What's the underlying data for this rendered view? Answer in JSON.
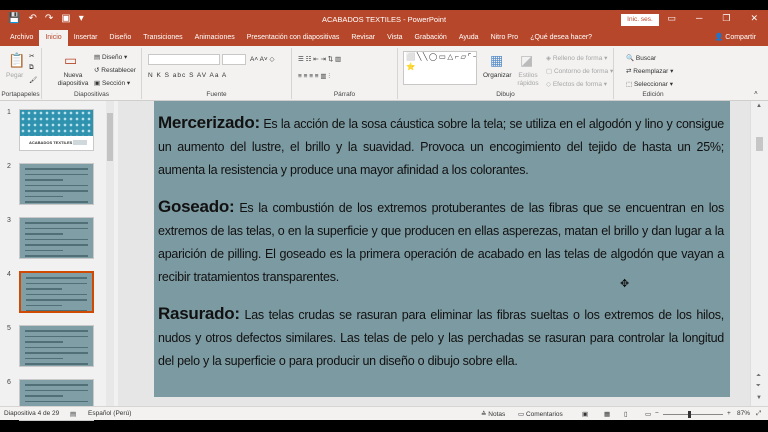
{
  "window": {
    "title": "ACABADOS TEXTILES  -  PowerPoint",
    "sign_in": "Inic. ses.",
    "quick_access": [
      "💾",
      "↶",
      "↷",
      "▣",
      "▾"
    ],
    "controls": [
      "▭",
      "─",
      "❐",
      "✕"
    ]
  },
  "tabs": [
    "Archivo",
    "Inicio",
    "Insertar",
    "Diseño",
    "Transiciones",
    "Animaciones",
    "Presentación con diapositivas",
    "Revisar",
    "Vista",
    "Grabación",
    "Ayuda",
    "Nitro Pro",
    "¿Qué desea hacer?"
  ],
  "active_tab": "Inicio",
  "share_label": "Compartir",
  "ribbon": {
    "portapapeles": {
      "paste": "Pegar",
      "label": "Portapapeles"
    },
    "diapositivas": {
      "new_slide": "Nueva diapositiva",
      "layout": "Diseño",
      "reset": "Restablecer",
      "section": "Sección",
      "label": "Diapositivas"
    },
    "fuente": {
      "format_buttons": "N  K  S  abc  S  AV  Aa  A",
      "label": "Fuente"
    },
    "parrafo": {
      "label": "Párrafo"
    },
    "dibujo": {
      "shapes": "⬜╲╲◯▭△⌐▱⌜⟶⬠⟨⟩⭐",
      "arrange": "Organizar",
      "quick_styles": "Estilos rápidos",
      "fill": "Relleno de forma",
      "outline": "Contorno de forma",
      "effects": "Efectos de forma",
      "label": "Dibujo"
    },
    "edicion": {
      "find": "Buscar",
      "replace": "Reemplazar",
      "select": "Seleccionar",
      "label": "Edición"
    }
  },
  "thumbnails": [
    {
      "num": "1",
      "title": "ACABADOS TEXTILES"
    },
    {
      "num": "2"
    },
    {
      "num": "3"
    },
    {
      "num": "4",
      "selected": true
    },
    {
      "num": "5"
    },
    {
      "num": "6"
    }
  ],
  "slide": {
    "paragraphs": [
      {
        "term": "Mercerizado:",
        "text": " Es la acción de la sosa cáustica sobre la tela; se utiliza en el algodón y lino y consigue un aumento del lustre, el brillo y la suavidad. Provoca un encogimiento del tejido de hasta un 25%; aumenta la resistencia y produce una mayor afinidad a los colorantes."
      },
      {
        "term": "Goseado:",
        "text": " Es la combustión de los extremos protuberantes de las fibras que se encuentran en los extremos de las telas, o en la superficie y que producen en ellas asperezas, matan el brillo y dan lugar a la aparición de pilling. El goseado es la primera operación de acabado en las telas de algodón que vayan a recibir tratamientos transparentes."
      },
      {
        "term": "Rasurado:",
        "text": " Las telas crudas se rasuran para eliminar las fibras sueltas o los extremos de los hilos, nudos y otros defectos similares. Las telas de pelo y las perchadas se rasuran para controlar la longitud del pelo y la superficie o para producir un diseño o dibujo sobre ella."
      }
    ]
  },
  "status": {
    "slide_info": "Diapositiva 4 de 29",
    "language": "Español (Perú)",
    "notes": "Notas",
    "comments": "Comentarios",
    "zoom": "87%",
    "zoom_level": 0.87
  },
  "colors": {
    "accent": "#b7472a",
    "slide_bg": "#7c9aa1"
  }
}
